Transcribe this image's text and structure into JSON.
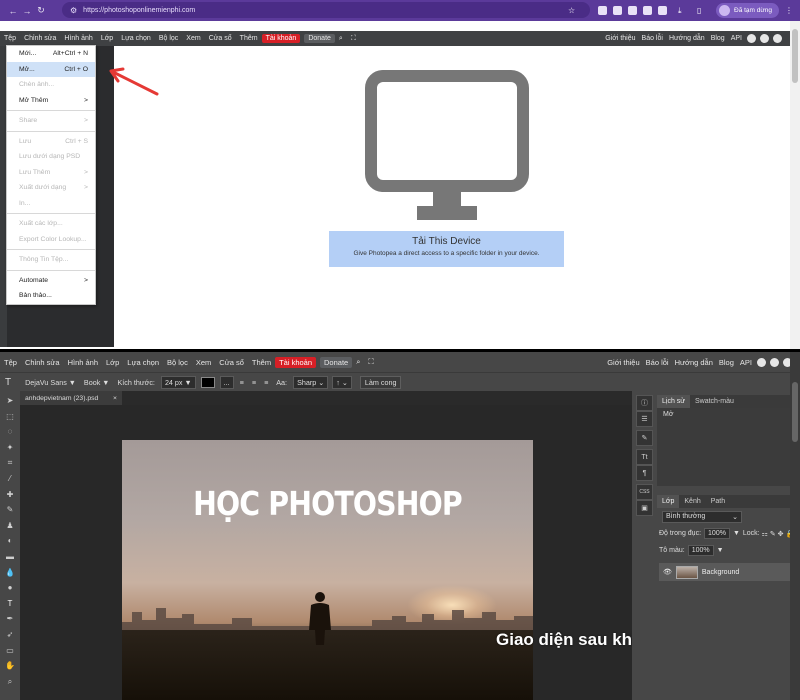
{
  "browser": {
    "url": "https://photoshoponlinemienphi.com",
    "pause_label": "Đã tạm dừng"
  },
  "menubar": {
    "items": [
      "Tệp",
      "Chỉnh sửa",
      "Hình ảnh",
      "Lớp",
      "Lựa chọn",
      "Bộ lọc",
      "Xem",
      "Cửa sổ",
      "Thêm"
    ],
    "account": "Tài khoản",
    "donate": "Donate",
    "right": [
      "Giới thiệu",
      "Báo lỗi",
      "Hướng dẫn",
      "Blog",
      "API"
    ]
  },
  "file_menu": {
    "items": [
      {
        "label": "Mới...",
        "shortcut": "Alt+Ctrl + N",
        "disabled": false
      },
      {
        "label": "Mở...",
        "shortcut": "Ctrl + O",
        "disabled": false,
        "highlighted": true
      },
      {
        "label": "Chèn ảnh...",
        "shortcut": "",
        "disabled": true
      },
      {
        "label": "Mở Thêm",
        "shortcut": ">",
        "disabled": false
      },
      {
        "label": "Share",
        "shortcut": ">",
        "disabled": true
      },
      {
        "label": "Lưu",
        "shortcut": "Ctrl + S",
        "disabled": true
      },
      {
        "label": "Lưu dưới dạng PSD",
        "shortcut": "",
        "disabled": true
      },
      {
        "label": "Lưu Thêm",
        "shortcut": ">",
        "disabled": true
      },
      {
        "label": "Xuất dưới dạng",
        "shortcut": ">",
        "disabled": true
      },
      {
        "label": "In...",
        "shortcut": "",
        "disabled": true
      },
      {
        "label": "Xuất các lớp...",
        "shortcut": "",
        "disabled": true
      },
      {
        "label": "Export Color Lookup...",
        "shortcut": "",
        "disabled": true
      },
      {
        "label": "Thông Tin Tệp...",
        "shortcut": "",
        "disabled": true
      },
      {
        "label": "Automate",
        "shortcut": ">",
        "disabled": false
      },
      {
        "label": "Bản thảo...",
        "shortcut": "",
        "disabled": false
      }
    ]
  },
  "device_panel": {
    "title": "Tải This Device",
    "subtitle": "Give Photopea a direct access to a specific folder in your device."
  },
  "options_bar": {
    "font": "DejaVu Sans",
    "style": "Book",
    "size_label": "Kích thước:",
    "size_value": "24 px",
    "more": "...",
    "aa_label": "Aa:",
    "aa_value": "Sharp",
    "line": "↑",
    "warp_button": "Làm cong"
  },
  "document_tab": {
    "name": "anhdepvietnam (23).psd",
    "close": "×"
  },
  "photo_text": "HỌC PHOTOSHOP",
  "caption": "Giao diện sau khi mở ảnh lên",
  "history_panel": {
    "tabs": [
      "Lịch sử",
      "Swatch-màu"
    ],
    "entries": [
      "Mở"
    ]
  },
  "layers_panel": {
    "tabs": [
      "Lớp",
      "Kênh",
      "Path"
    ],
    "blend_mode": "Bình thường",
    "opacity_label": "Độ trong đục:",
    "opacity_value": "100%",
    "lock_label": "Lock:",
    "fill_label": "Tô màu:",
    "fill_value": "100%",
    "layers": [
      {
        "name": "Background"
      }
    ]
  },
  "right_strip_labels": [
    "CSS"
  ],
  "colors": {
    "accent_red": "#d71f26",
    "menubar": "#3f4143",
    "browser_frame": "#5b3a9a",
    "highlight": "#cfe1f7",
    "device_panel": "#b4cff6"
  }
}
